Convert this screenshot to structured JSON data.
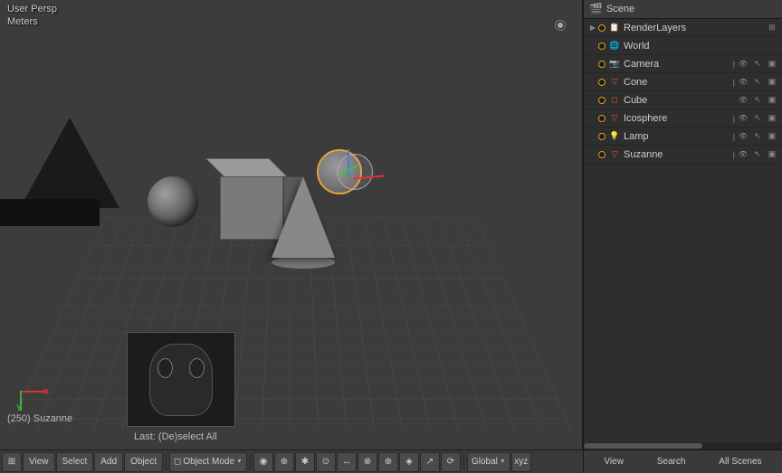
{
  "viewport": {
    "mode_label": "User Persp",
    "unit_label": "Meters",
    "status_label": "(250) Suzanne",
    "last_op_label": "Last: (De)select All"
  },
  "outliner": {
    "header_label": "Scene",
    "items": [
      {
        "id": "render-layers",
        "label": "RenderLayers",
        "icon": "render-layers",
        "depth": 1,
        "has_expand": true
      },
      {
        "id": "world",
        "label": "World",
        "icon": "world",
        "depth": 1,
        "has_expand": false
      },
      {
        "id": "camera",
        "label": "Camera",
        "icon": "camera",
        "depth": 1,
        "has_expand": false,
        "has_sep": true
      },
      {
        "id": "cone",
        "label": "Cone",
        "icon": "cone",
        "depth": 1,
        "has_expand": false,
        "has_sep": true
      },
      {
        "id": "cube",
        "label": "Cube",
        "icon": "cube",
        "depth": 1,
        "has_expand": false,
        "has_sep": false
      },
      {
        "id": "icosphere",
        "label": "Icosphere",
        "icon": "icosphere",
        "depth": 1,
        "has_expand": false,
        "has_sep": true
      },
      {
        "id": "lamp",
        "label": "Lamp",
        "icon": "lamp",
        "depth": 1,
        "has_expand": false,
        "has_sep": true
      },
      {
        "id": "suzanne",
        "label": "Suzanne",
        "icon": "suzanne",
        "depth": 1,
        "has_expand": false,
        "has_sep": true
      }
    ],
    "scroll_label": ""
  },
  "bottom_toolbar": {
    "mode_icon": "grid-icon",
    "view_label": "View",
    "select_label": "Select",
    "add_label": "Add",
    "object_label": "Object",
    "object_mode_label": "Object Mode",
    "global_label": "Global",
    "all_scenes_label": "All Scenes",
    "view_right_label": "View",
    "search_label": "Search"
  },
  "icons": {
    "eye": "👁",
    "cursor": "↖",
    "camera": "📷",
    "world": "🌐",
    "render": "📋",
    "expand": "▶",
    "dropdown_arrow": "▼",
    "grid": "⊞",
    "scene": "🎬"
  }
}
